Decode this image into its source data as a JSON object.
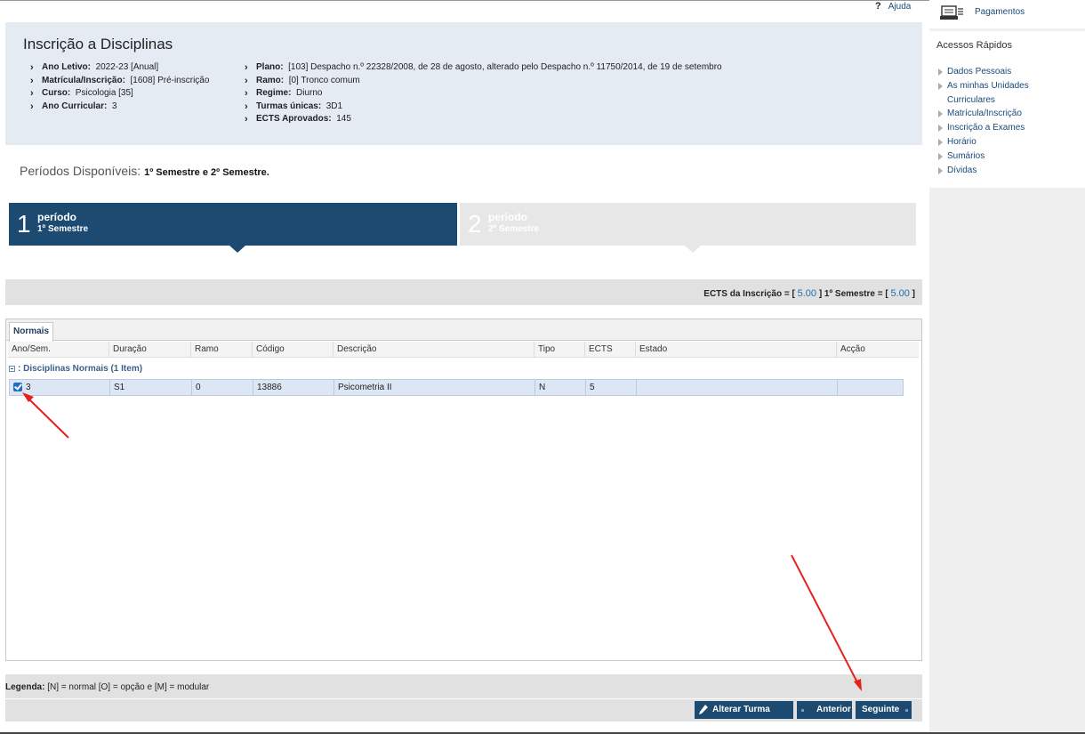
{
  "help": {
    "icon": "question-icon",
    "label": "Ajuda"
  },
  "sidebar": {
    "payments_label": "Pagamentos",
    "payments_icon": "cash-register-icon",
    "quick_title": "Acessos Rápidos",
    "quick_items": [
      {
        "label": "Dados Pessoais"
      },
      {
        "label": "As minhas Unidades"
      },
      {
        "label": "Curriculares"
      },
      {
        "label": "Matrícula/Inscrição"
      },
      {
        "label": "Inscrição a Exames"
      },
      {
        "label": "Horário"
      },
      {
        "label": "Sumários"
      },
      {
        "label": "Dívidas"
      }
    ]
  },
  "header": {
    "title": "Inscrição a Disciplinas",
    "left": [
      {
        "label": "Ano Letivo:",
        "value": "2022-23 [Anual]"
      },
      {
        "label": "Matrícula/Inscrição:",
        "value": "[1608] Pré-inscrição"
      },
      {
        "label": "Curso:",
        "value": "Psicologia [35]"
      },
      {
        "label": "Ano Curricular:",
        "value": "3"
      }
    ],
    "right": [
      {
        "label": "Plano:",
        "value": "[103] Despacho n.º 22328/2008, de 28 de agosto, alterado pelo Despacho n.º 11750/2014, de 19 de setembro"
      },
      {
        "label": "Ramo:",
        "value": "[0] Tronco comum"
      },
      {
        "label": "Regime:",
        "value": "Diurno"
      },
      {
        "label": "Turmas únicas:",
        "value": "3D1"
      },
      {
        "label": "ECTS Aprovados:",
        "value": "145"
      }
    ]
  },
  "periods": {
    "label": "Períodos Disponíveis:",
    "value": "1º Semestre e 2º Semestre."
  },
  "steps": [
    {
      "num": "1",
      "title": "período",
      "subtitle": "1º Semestre",
      "active": true
    },
    {
      "num": "2",
      "title": "período",
      "subtitle": "2º Semestre",
      "active": false
    }
  ],
  "ects": {
    "label1": "ECTS da Inscrição = [",
    "value1": "5.00",
    "label2": "] 1º Semestre = [",
    "value2": "5.00",
    "label3": "]"
  },
  "grid": {
    "tab": "Normais",
    "columns": [
      "Ano/Sem.",
      "Duração",
      "Ramo",
      "Código",
      "Descrição",
      "Tipo",
      "ECTS",
      "Estado",
      "Acção"
    ],
    "group": ": Disciplinas Normais (1 Item)",
    "rows": [
      {
        "checked": true,
        "ano": "3",
        "duracao": "S1",
        "ramo": "0",
        "codigo": "13886",
        "descricao": "Psicometria II",
        "tipo": "N",
        "ects": "5",
        "estado": "",
        "accao": ""
      }
    ]
  },
  "legend": {
    "label": "Legenda:",
    "text": "[N] = normal [O] = opção e [M] = modular"
  },
  "buttons": {
    "alterar": "Alterar Turma Única",
    "anterior": "Anterior",
    "seguinte": "Seguinte"
  },
  "colors": {
    "primary": "#1d4a71",
    "header_bg": "#e5ebf3",
    "link": "#1a4a7a",
    "annotation": "#e8201c"
  }
}
